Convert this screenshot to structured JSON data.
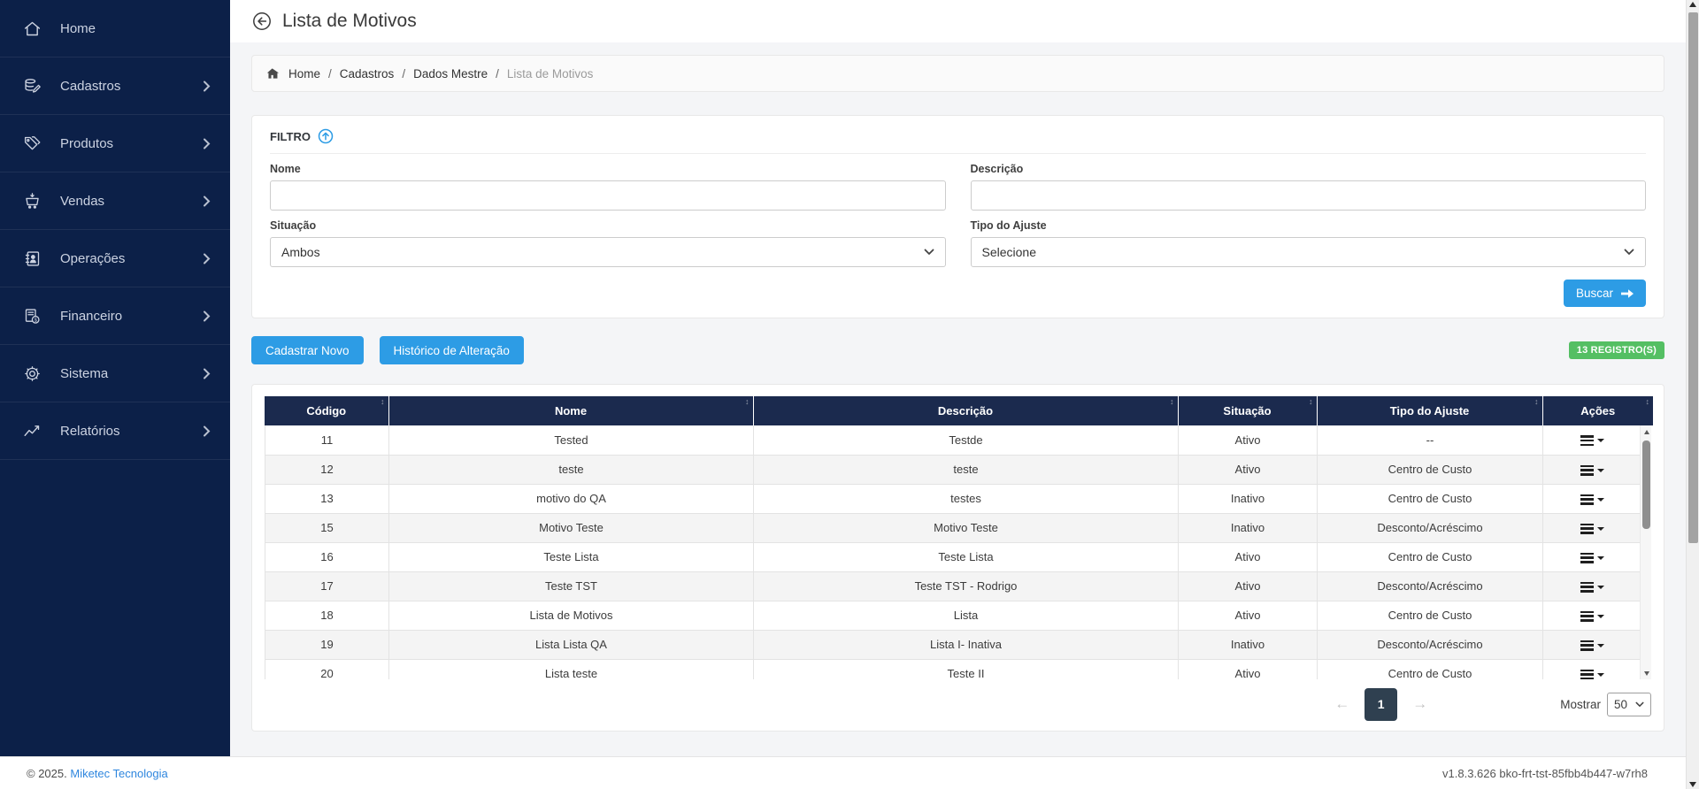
{
  "sidebar": {
    "items": [
      {
        "label": "Home",
        "icon": "home-icon"
      },
      {
        "label": "Cadastros",
        "icon": "database-edit-icon"
      },
      {
        "label": "Produtos",
        "icon": "tags-icon"
      },
      {
        "label": "Vendas",
        "icon": "cart-icon"
      },
      {
        "label": "Operações",
        "icon": "address-book-icon"
      },
      {
        "label": "Financeiro",
        "icon": "invoice-money-icon"
      },
      {
        "label": "Sistema",
        "icon": "gear-icon"
      },
      {
        "label": "Relatórios",
        "icon": "chart-line-icon"
      }
    ]
  },
  "header": {
    "title": "Lista de Motivos"
  },
  "breadcrumb": {
    "separator": "/",
    "items": [
      "Home",
      "Cadastros",
      "Dados Mestre"
    ],
    "current": "Lista de Motivos"
  },
  "filter": {
    "title": "FILTRO",
    "nome_label": "Nome",
    "nome_value": "",
    "descricao_label": "Descrição",
    "descricao_value": "",
    "situacao_label": "Situação",
    "situacao_value": "Ambos",
    "tipo_label": "Tipo do Ajuste",
    "tipo_value": "Selecione",
    "buscar_label": "Buscar"
  },
  "actions": {
    "cadastrar_novo": "Cadastrar Novo",
    "historico": "Histórico de Alteração",
    "registros_badge": "13 REGISTRO(S)"
  },
  "table": {
    "columns": [
      "Código",
      "Nome",
      "Descrição",
      "Situação",
      "Tipo do Ajuste",
      "Ações"
    ],
    "rows": [
      {
        "codigo": "11",
        "nome": "Tested",
        "descricao": "Testde",
        "situacao": "Ativo",
        "tipo": "--"
      },
      {
        "codigo": "12",
        "nome": "teste",
        "descricao": "teste",
        "situacao": "Ativo",
        "tipo": "Centro de Custo"
      },
      {
        "codigo": "13",
        "nome": "motivo do QA",
        "descricao": "testes",
        "situacao": "Inativo",
        "tipo": "Centro de Custo"
      },
      {
        "codigo": "15",
        "nome": "Motivo Teste",
        "descricao": "Motivo Teste",
        "situacao": "Inativo",
        "tipo": "Desconto/Acréscimo"
      },
      {
        "codigo": "16",
        "nome": "Teste Lista",
        "descricao": "Teste Lista",
        "situacao": "Ativo",
        "tipo": "Centro de Custo"
      },
      {
        "codigo": "17",
        "nome": "Teste TST",
        "descricao": "Teste TST - Rodrigo",
        "situacao": "Ativo",
        "tipo": "Desconto/Acréscimo"
      },
      {
        "codigo": "18",
        "nome": "Lista de Motivos",
        "descricao": "Lista",
        "situacao": "Ativo",
        "tipo": "Centro de Custo"
      },
      {
        "codigo": "19",
        "nome": "Lista Lista QA",
        "descricao": "Lista I- Inativa",
        "situacao": "Inativo",
        "tipo": "Desconto/Acréscimo"
      },
      {
        "codigo": "20",
        "nome": "Lista teste",
        "descricao": "Teste II",
        "situacao": "Ativo",
        "tipo": "Centro de Custo"
      }
    ]
  },
  "pagination": {
    "prev": "←",
    "page": "1",
    "next": "→",
    "mostrar_label": "Mostrar",
    "page_size": "50"
  },
  "footer": {
    "copyright": "© 2025.",
    "company_link": "Miketec Tecnologia",
    "version": "v1.8.3.626 bko-frt-tst-85fbb4b447-w7rh8"
  },
  "colors": {
    "sidebar_bg": "#0c2048",
    "table_header_bg": "#1b2a4e",
    "primary_blue": "#2d9ce5",
    "badge_green": "#54bf63",
    "link_blue": "#2e86de",
    "page_button_bg": "#2f4050"
  }
}
